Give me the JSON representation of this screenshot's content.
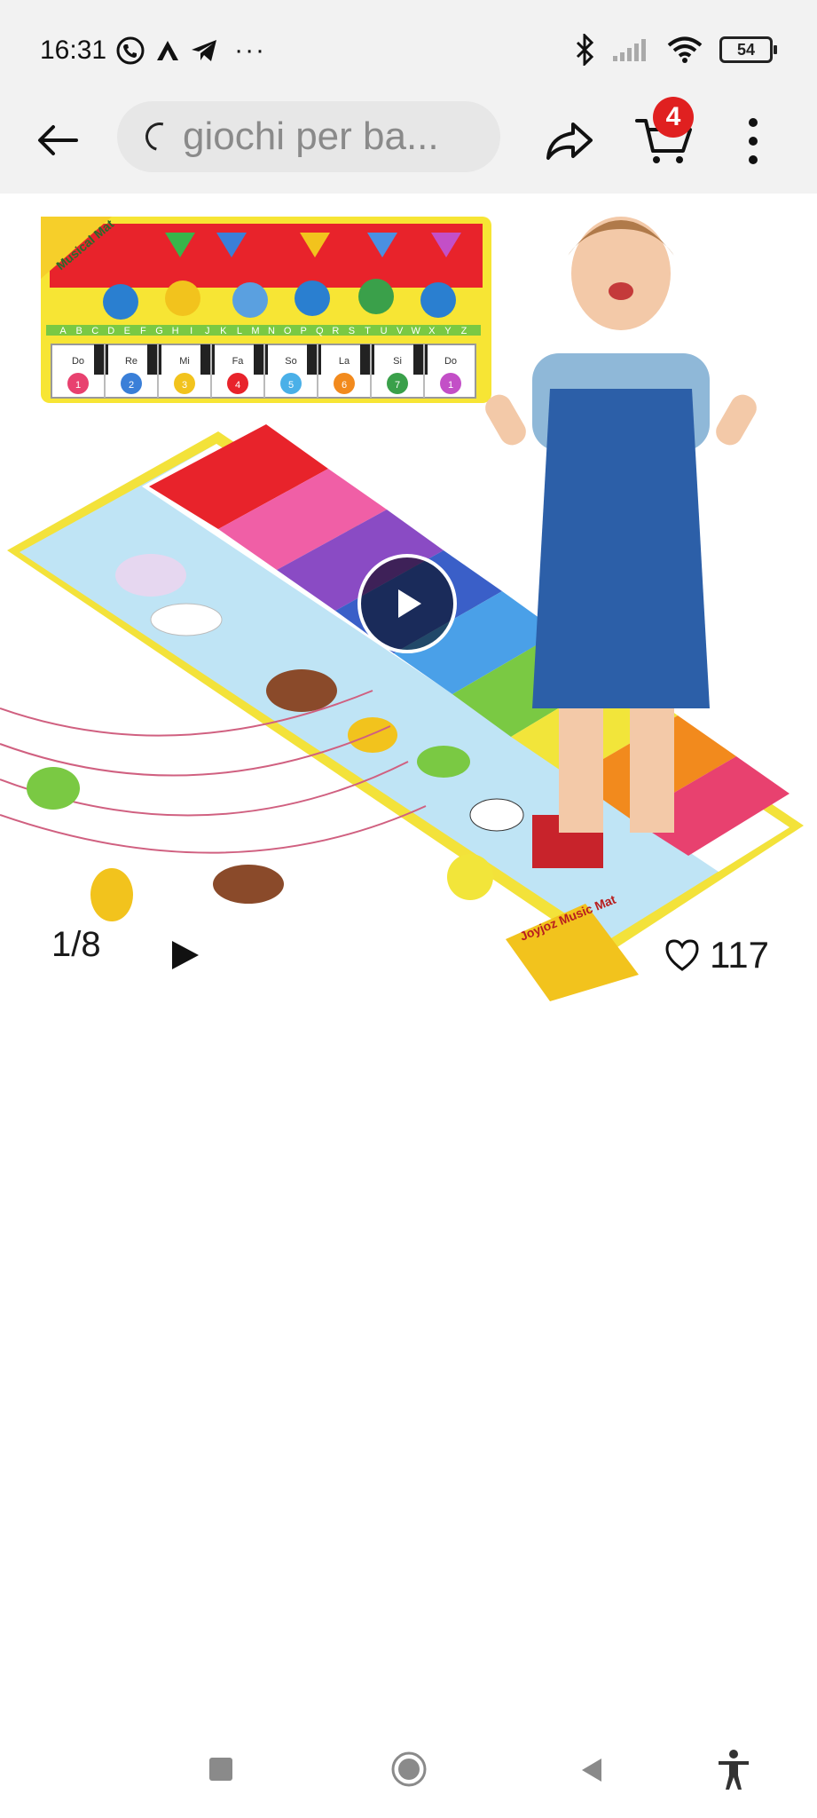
{
  "status_bar": {
    "time": "16:31",
    "battery": "54",
    "more_indicator": "···"
  },
  "top_bar": {
    "search_text": "giochi per ba...",
    "cart_count": "4"
  },
  "gallery": {
    "image_counter": "1/8",
    "likes": "117",
    "mat_small_label": "Musical Mat",
    "mat_big_label": "Joyjoz Music Mat",
    "keyboard_letters": [
      "A",
      "B",
      "C",
      "D",
      "E",
      "F",
      "G",
      "H",
      "I",
      "J",
      "K",
      "L",
      "M",
      "N",
      "O",
      "P",
      "Q",
      "R",
      "S",
      "T",
      "U",
      "V",
      "W",
      "X",
      "Y",
      "Z"
    ],
    "keys": [
      "Do",
      "Re",
      "Mi",
      "Fa",
      "So",
      "La",
      "Si",
      "Do"
    ],
    "key_numbers": [
      "1",
      "2",
      "3",
      "4",
      "5",
      "6",
      "7",
      "1"
    ]
  },
  "colors": {
    "accent": "#e02020",
    "status_bg": "#f2f2f2",
    "search_bg": "#e7e7e7"
  }
}
